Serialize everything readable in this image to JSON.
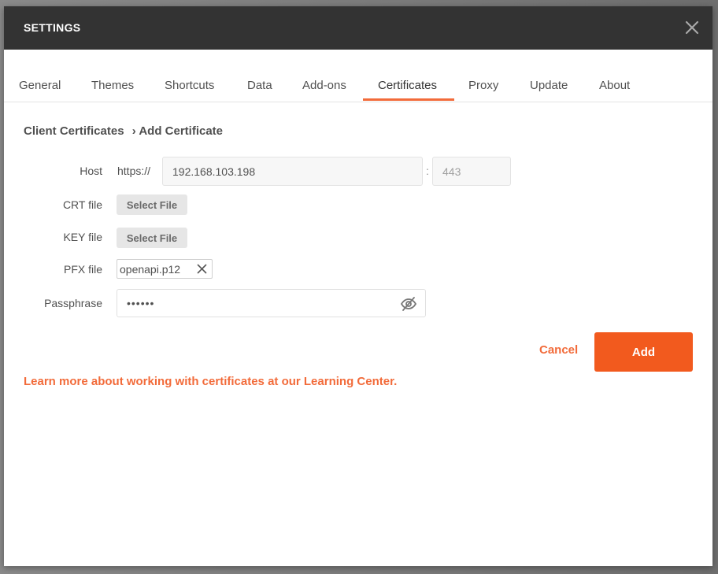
{
  "modal": {
    "title": "SETTINGS"
  },
  "tabs": [
    {
      "label": "General"
    },
    {
      "label": "Themes"
    },
    {
      "label": "Shortcuts"
    },
    {
      "label": "Data"
    },
    {
      "label": "Add-ons"
    },
    {
      "label": "Certificates",
      "active": true
    },
    {
      "label": "Proxy"
    },
    {
      "label": "Update"
    },
    {
      "label": "About"
    }
  ],
  "breadcrumb": {
    "parent": "Client Certificates",
    "current": "› Add Certificate"
  },
  "form": {
    "host_label": "Host",
    "host_prefix": "https://",
    "host_value": "192.168.103.198",
    "port_placeholder": "443",
    "port_separator": ":",
    "crt_label": "CRT file",
    "crt_button": "Select File",
    "key_label": "KEY file",
    "key_button": "Select File",
    "pfx_label": "PFX file",
    "pfx_value": "openapi.p12",
    "passphrase_label": "Passphrase",
    "passphrase_value": "••••••"
  },
  "actions": {
    "cancel": "Cancel",
    "add": "Add"
  },
  "learn_more": "Learn more about working with certificates at our Learning Center.",
  "colors": {
    "accent": "#f26b3a",
    "primary_button": "#f25a1e",
    "header_bg": "#333333"
  },
  "icons": {
    "close": "close-icon",
    "remove_file": "close-icon",
    "visibility": "eye-slash-icon"
  }
}
